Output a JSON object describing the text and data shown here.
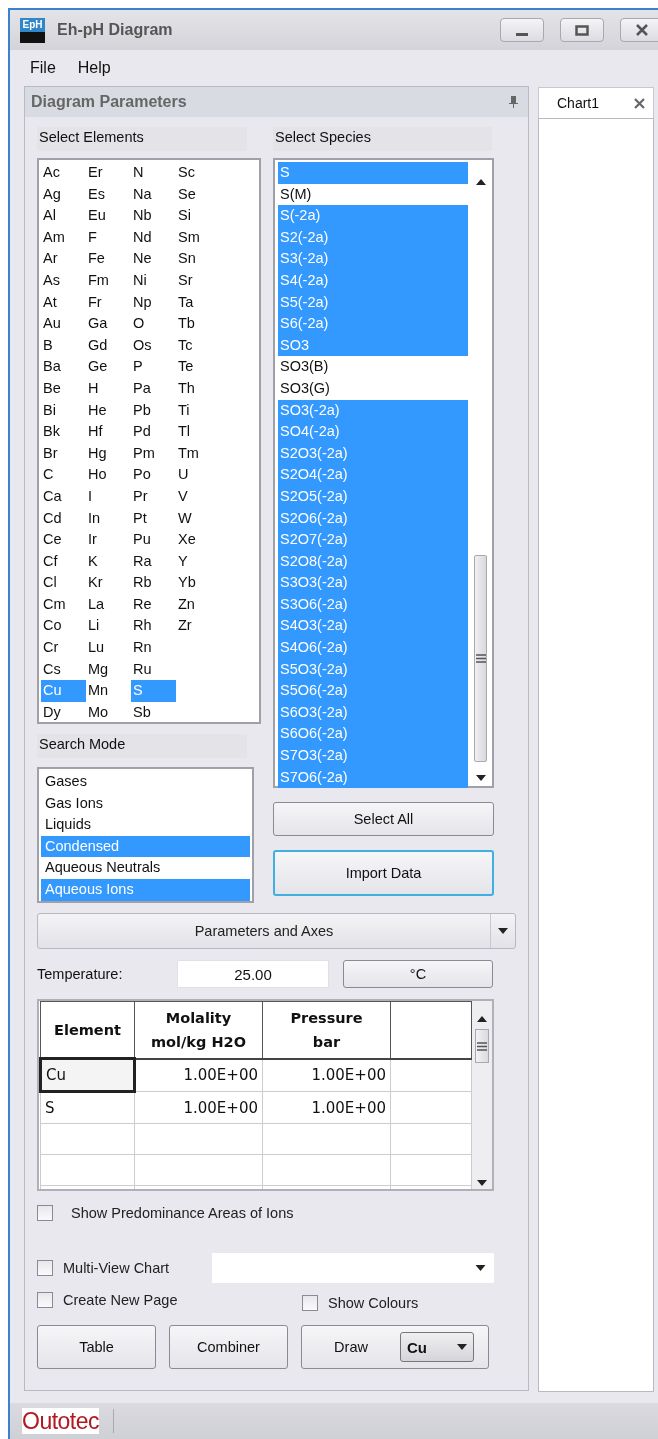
{
  "window": {
    "title": "Eh-pH Diagram",
    "icon_text": "EpH"
  },
  "menu": [
    "File",
    "Help"
  ],
  "panel": {
    "title": "Diagram Parameters"
  },
  "elements": {
    "label": "Select Elements",
    "items": [
      {
        "symbol": "Ac",
        "selected": false
      },
      {
        "symbol": "Ag",
        "selected": false
      },
      {
        "symbol": "Al",
        "selected": false
      },
      {
        "symbol": "Am",
        "selected": false
      },
      {
        "symbol": "Ar",
        "selected": false
      },
      {
        "symbol": "As",
        "selected": false
      },
      {
        "symbol": "At",
        "selected": false
      },
      {
        "symbol": "Au",
        "selected": false
      },
      {
        "symbol": "B",
        "selected": false
      },
      {
        "symbol": "Ba",
        "selected": false
      },
      {
        "symbol": "Be",
        "selected": false
      },
      {
        "symbol": "Bi",
        "selected": false
      },
      {
        "symbol": "Bk",
        "selected": false
      },
      {
        "symbol": "Br",
        "selected": false
      },
      {
        "symbol": "C",
        "selected": false
      },
      {
        "symbol": "Ca",
        "selected": false
      },
      {
        "symbol": "Cd",
        "selected": false
      },
      {
        "symbol": "Ce",
        "selected": false
      },
      {
        "symbol": "Cf",
        "selected": false
      },
      {
        "symbol": "Cl",
        "selected": false
      },
      {
        "symbol": "Cm",
        "selected": false
      },
      {
        "symbol": "Co",
        "selected": false
      },
      {
        "symbol": "Cr",
        "selected": false
      },
      {
        "symbol": "Cs",
        "selected": false
      },
      {
        "symbol": "Cu",
        "selected": true
      },
      {
        "symbol": "Dy",
        "selected": false
      },
      {
        "symbol": "Er",
        "selected": false
      },
      {
        "symbol": "Es",
        "selected": false
      },
      {
        "symbol": "Eu",
        "selected": false
      },
      {
        "symbol": "F",
        "selected": false
      },
      {
        "symbol": "Fe",
        "selected": false
      },
      {
        "symbol": "Fm",
        "selected": false
      },
      {
        "symbol": "Fr",
        "selected": false
      },
      {
        "symbol": "Ga",
        "selected": false
      },
      {
        "symbol": "Gd",
        "selected": false
      },
      {
        "symbol": "Ge",
        "selected": false
      },
      {
        "symbol": "H",
        "selected": false
      },
      {
        "symbol": "He",
        "selected": false
      },
      {
        "symbol": "Hf",
        "selected": false
      },
      {
        "symbol": "Hg",
        "selected": false
      },
      {
        "symbol": "Ho",
        "selected": false
      },
      {
        "symbol": "I",
        "selected": false
      },
      {
        "symbol": "In",
        "selected": false
      },
      {
        "symbol": "Ir",
        "selected": false
      },
      {
        "symbol": "K",
        "selected": false
      },
      {
        "symbol": "Kr",
        "selected": false
      },
      {
        "symbol": "La",
        "selected": false
      },
      {
        "symbol": "Li",
        "selected": false
      },
      {
        "symbol": "Lu",
        "selected": false
      },
      {
        "symbol": "Mg",
        "selected": false
      },
      {
        "symbol": "Mn",
        "selected": false
      },
      {
        "symbol": "Mo",
        "selected": false
      },
      {
        "symbol": "N",
        "selected": false
      },
      {
        "symbol": "Na",
        "selected": false
      },
      {
        "symbol": "Nb",
        "selected": false
      },
      {
        "symbol": "Nd",
        "selected": false
      },
      {
        "symbol": "Ne",
        "selected": false
      },
      {
        "symbol": "Ni",
        "selected": false
      },
      {
        "symbol": "Np",
        "selected": false
      },
      {
        "symbol": "O",
        "selected": false
      },
      {
        "symbol": "Os",
        "selected": false
      },
      {
        "symbol": "P",
        "selected": false
      },
      {
        "symbol": "Pa",
        "selected": false
      },
      {
        "symbol": "Pb",
        "selected": false
      },
      {
        "symbol": "Pd",
        "selected": false
      },
      {
        "symbol": "Pm",
        "selected": false
      },
      {
        "symbol": "Po",
        "selected": false
      },
      {
        "symbol": "Pr",
        "selected": false
      },
      {
        "symbol": "Pt",
        "selected": false
      },
      {
        "symbol": "Pu",
        "selected": false
      },
      {
        "symbol": "Ra",
        "selected": false
      },
      {
        "symbol": "Rb",
        "selected": false
      },
      {
        "symbol": "Re",
        "selected": false
      },
      {
        "symbol": "Rh",
        "selected": false
      },
      {
        "symbol": "Rn",
        "selected": false
      },
      {
        "symbol": "Ru",
        "selected": false
      },
      {
        "symbol": "S",
        "selected": true
      },
      {
        "symbol": "Sb",
        "selected": false
      },
      {
        "symbol": "Sc",
        "selected": false
      },
      {
        "symbol": "Se",
        "selected": false
      },
      {
        "symbol": "Si",
        "selected": false
      },
      {
        "symbol": "Sm",
        "selected": false
      },
      {
        "symbol": "Sn",
        "selected": false
      },
      {
        "symbol": "Sr",
        "selected": false
      },
      {
        "symbol": "Ta",
        "selected": false
      },
      {
        "symbol": "Tb",
        "selected": false
      },
      {
        "symbol": "Tc",
        "selected": false
      },
      {
        "symbol": "Te",
        "selected": false
      },
      {
        "symbol": "Th",
        "selected": false
      },
      {
        "symbol": "Ti",
        "selected": false
      },
      {
        "symbol": "Tl",
        "selected": false
      },
      {
        "symbol": "Tm",
        "selected": false
      },
      {
        "symbol": "U",
        "selected": false
      },
      {
        "symbol": "V",
        "selected": false
      },
      {
        "symbol": "W",
        "selected": false
      },
      {
        "symbol": "Xe",
        "selected": false
      },
      {
        "symbol": "Y",
        "selected": false
      },
      {
        "symbol": "Yb",
        "selected": false
      },
      {
        "symbol": "Zn",
        "selected": false
      },
      {
        "symbol": "Zr",
        "selected": false
      }
    ]
  },
  "species": {
    "label": "Select Species",
    "items": [
      {
        "name": "S",
        "selected": true
      },
      {
        "name": "S(M)",
        "selected": false
      },
      {
        "name": "S(-2a)",
        "selected": true
      },
      {
        "name": "S2(-2a)",
        "selected": true
      },
      {
        "name": "S3(-2a)",
        "selected": true
      },
      {
        "name": "S4(-2a)",
        "selected": true
      },
      {
        "name": "S5(-2a)",
        "selected": true
      },
      {
        "name": "S6(-2a)",
        "selected": true
      },
      {
        "name": "SO3",
        "selected": true
      },
      {
        "name": "SO3(B)",
        "selected": false
      },
      {
        "name": "SO3(G)",
        "selected": false
      },
      {
        "name": "SO3(-2a)",
        "selected": true
      },
      {
        "name": "SO4(-2a)",
        "selected": true
      },
      {
        "name": "S2O3(-2a)",
        "selected": true
      },
      {
        "name": "S2O4(-2a)",
        "selected": true
      },
      {
        "name": "S2O5(-2a)",
        "selected": true
      },
      {
        "name": "S2O6(-2a)",
        "selected": true
      },
      {
        "name": "S2O7(-2a)",
        "selected": true
      },
      {
        "name": "S2O8(-2a)",
        "selected": true
      },
      {
        "name": "S3O3(-2a)",
        "selected": true
      },
      {
        "name": "S3O6(-2a)",
        "selected": true
      },
      {
        "name": "S4O3(-2a)",
        "selected": true
      },
      {
        "name": "S4O6(-2a)",
        "selected": true
      },
      {
        "name": "S5O3(-2a)",
        "selected": true
      },
      {
        "name": "S5O6(-2a)",
        "selected": true
      },
      {
        "name": "S6O3(-2a)",
        "selected": true
      },
      {
        "name": "S6O6(-2a)",
        "selected": true
      },
      {
        "name": "S7O3(-2a)",
        "selected": true
      },
      {
        "name": "S7O6(-2a)",
        "selected": true
      }
    ]
  },
  "search_mode": {
    "label": "Search Mode",
    "items": [
      {
        "name": "Gases",
        "selected": false
      },
      {
        "name": "Gas Ions",
        "selected": false
      },
      {
        "name": "Liquids",
        "selected": false
      },
      {
        "name": "Condensed",
        "selected": true
      },
      {
        "name": "Aqueous Neutrals",
        "selected": false
      },
      {
        "name": "Aqueous Ions",
        "selected": true
      }
    ]
  },
  "side_buttons": [
    {
      "label": "Select All",
      "focused": false
    },
    {
      "label": "Import Data",
      "focused": true
    }
  ],
  "section_dropdown": "Parameters and Axes",
  "temperature": {
    "label": "Temperature:",
    "value": "25.00",
    "unit": "°C"
  },
  "table": {
    "columns": [
      "Element",
      "Molality\nmol/kg H2O",
      "Pressure\nbar"
    ],
    "rows": [
      {
        "cells": [
          {
            "text": "Cu",
            "focused": true
          },
          {
            "text": "1.00E+00",
            "focused": false
          },
          {
            "text": "1.00E+00",
            "focused": false
          }
        ]
      },
      {
        "cells": [
          {
            "text": "S",
            "focused": false
          },
          {
            "text": "1.00E+00",
            "focused": false
          },
          {
            "text": "1.00E+00",
            "focused": false
          }
        ]
      }
    ]
  },
  "show_predominance": {
    "label": "Show Predominance Areas of Ions",
    "checked": false
  },
  "multi_view": {
    "label": "Multi-View Chart",
    "checked": false
  },
  "create_new_page": {
    "label": "Create New Page",
    "checked": false
  },
  "show_colours": {
    "label": "Show Colours",
    "checked": false
  },
  "bottom_buttons": [
    "Table",
    "Combiner"
  ],
  "draw": {
    "label": "Draw",
    "element": "Cu"
  },
  "chart_tab": {
    "label": "Chart1"
  },
  "status_bar": {
    "logo": "Outotec"
  }
}
